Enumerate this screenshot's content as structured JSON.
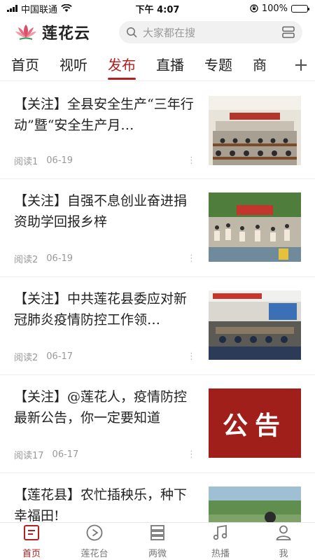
{
  "status_bar": {
    "carrier": "中国联通",
    "time": "下午 4:07",
    "battery": "100%",
    "battery_level": 1.0
  },
  "header": {
    "logo_text": "莲花云",
    "search_placeholder": "大家都在搜",
    "brand_color": "#b3201f"
  },
  "tabs": [
    {
      "label": "首页",
      "active": false
    },
    {
      "label": "视听",
      "active": false
    },
    {
      "label": "发布",
      "active": true
    },
    {
      "label": "直播",
      "active": false
    },
    {
      "label": "专题",
      "active": false
    },
    {
      "label": "商",
      "active": false
    }
  ],
  "tab_add_icon": "+",
  "news": [
    {
      "title": "【关注】全县安全生产“三年行动”暨“安全生产月…",
      "reads": "阅读1",
      "date": "06-19",
      "image": "meeting-hall"
    },
    {
      "title": "【关注】自强不息创业奋进捐资助学回报乡梓",
      "reads": "阅读2",
      "date": "06-19",
      "image": "outdoor-ceremony"
    },
    {
      "title": "【关注】中共莲花县委应对新冠肺炎疫情防控工作领…",
      "reads": "阅读2",
      "date": "06-17",
      "image": "conference-room"
    },
    {
      "title": "【关注】@莲花人，疫情防控最新公告，你一定要知道",
      "reads": "阅读17",
      "date": "06-17",
      "image": "notice",
      "image_text": "公告"
    },
    {
      "title": "【莲花县】农忙插秧乐，种下幸福田!",
      "reads": "",
      "date": "",
      "image": "rice-field"
    }
  ],
  "more_icon": "⋮",
  "bottom_nav": [
    {
      "label": "首页",
      "icon": "home-icon",
      "active": true
    },
    {
      "label": "莲花台",
      "icon": "play-circle-icon",
      "active": false
    },
    {
      "label": "两微",
      "icon": "stack-icon",
      "active": false
    },
    {
      "label": "热播",
      "icon": "music-icon",
      "active": false
    },
    {
      "label": "我",
      "icon": "user-icon",
      "active": false
    }
  ]
}
